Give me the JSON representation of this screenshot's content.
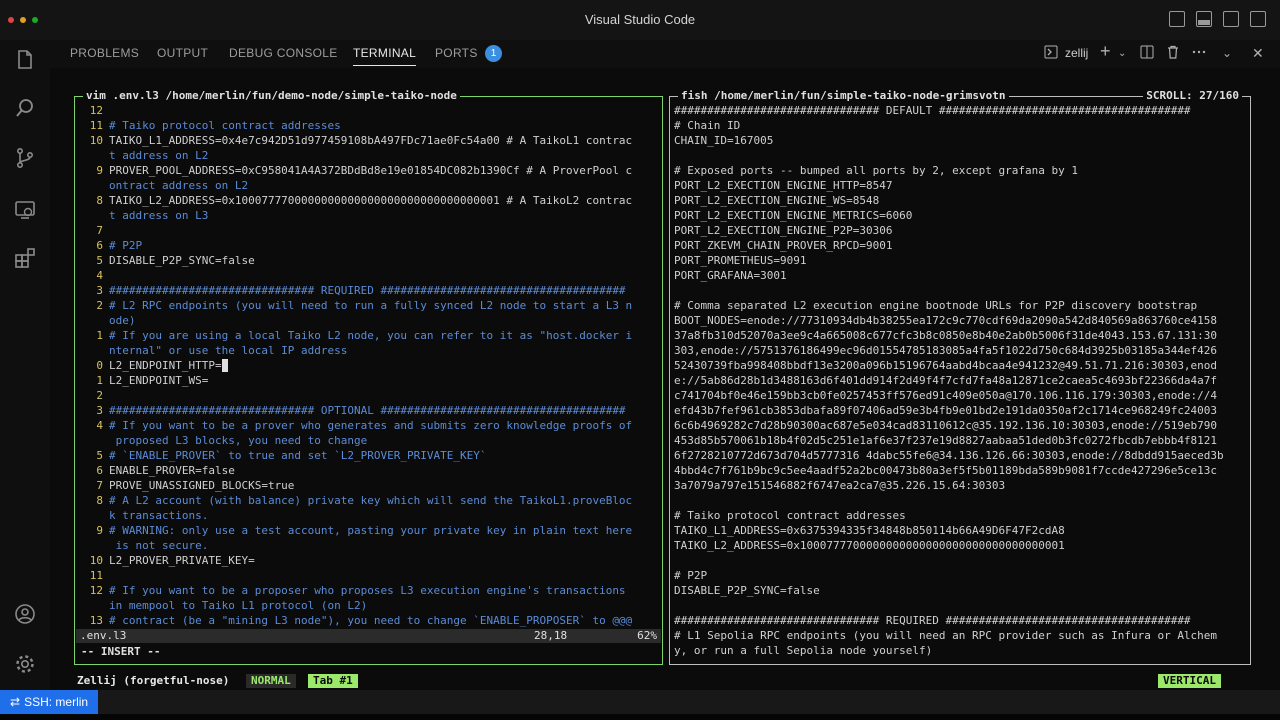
{
  "window": {
    "title": "Visual Studio Code"
  },
  "panel": {
    "tabs": [
      {
        "label": "PROBLEMS"
      },
      {
        "label": "OUTPUT"
      },
      {
        "label": "DEBUG CONSOLE"
      },
      {
        "label": "TERMINAL"
      },
      {
        "label": "PORTS"
      }
    ],
    "ports_badge": "1",
    "terminal_name": "zellij"
  },
  "left_pane": {
    "title": "vim .env.l3 /home/merlin/fun/demo-node/simple-taiko-node",
    "lines": [
      {
        "n": "12",
        "t": "",
        "c": false
      },
      {
        "n": "11",
        "t": "# Taiko protocol contract addresses",
        "c": true
      },
      {
        "n": "10",
        "t": "TAIKO_L1_ADDRESS=0x4e7c942D51d977459108bA497FDc71ae0Fc54a00 # A TaikoL1 contrac",
        "c": false
      },
      {
        "n": "",
        "t": "t address on L2",
        "c": true
      },
      {
        "n": "9",
        "t": "PROVER_POOL_ADDRESS=0xC958041A4A372BDdBd8e19e01854DC082b1390Cf # A ProverPool c",
        "c": false
      },
      {
        "n": "",
        "t": "ontract address on L2",
        "c": true
      },
      {
        "n": "8",
        "t": "TAIKO_L2_ADDRESS=0x1000777700000000000000000000000000000001 # A TaikoL2 contrac",
        "c": false
      },
      {
        "n": "",
        "t": "t address on L3",
        "c": true
      },
      {
        "n": "7",
        "t": "",
        "c": false
      },
      {
        "n": "6",
        "t": "# P2P",
        "c": true
      },
      {
        "n": "5",
        "t": "DISABLE_P2P_SYNC=false",
        "c": false
      },
      {
        "n": "4",
        "t": "",
        "c": false
      },
      {
        "n": "3",
        "t": "############################### REQUIRED #####################################",
        "c": true
      },
      {
        "n": "2",
        "t": "# L2 RPC endpoints (you will need to run a fully synced L2 node to start a L3 n",
        "c": true
      },
      {
        "n": "",
        "t": "ode)",
        "c": true
      },
      {
        "n": "1",
        "t": "# If you are using a local Taiko L2 node, you can refer to it as \"host.docker i",
        "c": true
      },
      {
        "n": "",
        "t": "nternal\" or use the local IP address",
        "c": true
      },
      {
        "n": "0",
        "t": "L2_ENDPOINT_HTTP=",
        "c": false,
        "cursor": true
      },
      {
        "n": "1",
        "t": "L2_ENDPOINT_WS=",
        "c": false
      },
      {
        "n": "2",
        "t": "",
        "c": false
      },
      {
        "n": "3",
        "t": "############################### OPTIONAL #####################################",
        "c": true
      },
      {
        "n": "4",
        "t": "# If you want to be a prover who generates and submits zero knowledge proofs of",
        "c": true
      },
      {
        "n": "",
        "t": " proposed L3 blocks, you need to change",
        "c": true
      },
      {
        "n": "5",
        "t": "# `ENABLE_PROVER` to true and set `L2_PROVER_PRIVATE_KEY`",
        "c": true
      },
      {
        "n": "6",
        "t": "ENABLE_PROVER=false",
        "c": false
      },
      {
        "n": "7",
        "t": "PROVE_UNASSIGNED_BLOCKS=true",
        "c": false
      },
      {
        "n": "8",
        "t": "# A L2 account (with balance) private key which will send the TaikoL1.proveBloc",
        "c": true
      },
      {
        "n": "",
        "t": "k transactions.",
        "c": true
      },
      {
        "n": "9",
        "t": "# WARNING: only use a test account, pasting your private key in plain text here",
        "c": true
      },
      {
        "n": "",
        "t": " is not secure.",
        "c": true
      },
      {
        "n": "10",
        "t": "L2_PROVER_PRIVATE_KEY=",
        "c": false
      },
      {
        "n": "11",
        "t": "",
        "c": false
      },
      {
        "n": "12",
        "t": "# If you want to be a proposer who proposes L3 execution engine's transactions",
        "c": true
      },
      {
        "n": "",
        "t": "in mempool to Taiko L1 protocol (on L2)",
        "c": true
      },
      {
        "n": "13",
        "t": "# contract (be a \"mining L3 node\"), you need to change `ENABLE_PROPOSER` to @@@",
        "c": true
      }
    ],
    "status": {
      "file": ".env.l3",
      "position": "28,18",
      "percent": "62%"
    },
    "mode": "-- INSERT --"
  },
  "right_pane": {
    "title": "fish /home/merlin/fun/simple-taiko-node-grimsvotn",
    "scroll": "SCROLL:  27/160",
    "lines": [
      {
        "t": "############################### DEFAULT ######################################",
        "c": false
      },
      {
        "t": "# Chain ID",
        "c": false
      },
      {
        "t": "CHAIN_ID=167005",
        "c": false
      },
      {
        "t": "",
        "c": false
      },
      {
        "t": "# Exposed ports -- bumped all ports by 2, except grafana by 1",
        "c": false
      },
      {
        "t": "PORT_L2_EXECTION_ENGINE_HTTP=8547",
        "c": false
      },
      {
        "t": "PORT_L2_EXECTION_ENGINE_WS=8548",
        "c": false
      },
      {
        "t": "PORT_L2_EXECTION_ENGINE_METRICS=6060",
        "c": false
      },
      {
        "t": "PORT_L2_EXECTION_ENGINE_P2P=30306",
        "c": false
      },
      {
        "t": "PORT_ZKEVM_CHAIN_PROVER_RPCD=9001",
        "c": false
      },
      {
        "t": "PORT_PROMETHEUS=9091",
        "c": false
      },
      {
        "t": "PORT_GRAFANA=3001",
        "c": false
      },
      {
        "t": "",
        "c": false
      },
      {
        "t": "# Comma separated L2 execution engine bootnode URLs for P2P discovery bootstrap",
        "c": false
      },
      {
        "t": "BOOT_NODES=enode://77310934db4b38255ea172c9c770cdf69da2090a542d840569a863760ce4158",
        "c": false
      },
      {
        "t": "37a8fb310d52070a3ee9c4a665008c677cfc3b8c0850e8b40e2ab0b5006f31de4043.153.67.131:30",
        "c": false
      },
      {
        "t": "303,enode://5751376186499ec96d01554785183085a4fa5f1022d750c684d3925b03185a344ef426",
        "c": false
      },
      {
        "t": "52430739fba998408bbdf13e3200a096b15196764aabd4bcaa4e941232@49.51.71.216:30303,enod",
        "c": false
      },
      {
        "t": "e://5ab86d28b1d3488163d6f401dd914f2d49f4f7cfd7fa48a12871ce2caea5c4693bf22366da4a7f",
        "c": false
      },
      {
        "t": "c741704bf0e46e159bb3cb0fe0257453ff576ed91c409e050a@170.106.116.179:30303,enode://4",
        "c": false
      },
      {
        "t": "efd43b7fef961cb3853dbafa89f07406ad59e3b4fb9e01bd2e191da0350af2c1714ce968249fc24003",
        "c": false
      },
      {
        "t": "6c6b4969282c7d28b90300ac687e5e034cad83110612c@35.192.136.10:30303,enode://519eb790",
        "c": false
      },
      {
        "t": "453d85b570061b18b4f02d5c251e1af6e37f237e19d8827aabaa51ded0b3fc0272fbcdb7ebbb4f8121",
        "c": false
      },
      {
        "t": "6f2728210772d673d704d5777316 4dabc55fe6@34.136.126.66:30303,enode://8dbdd915aeced3b",
        "c": false
      },
      {
        "t": "4bbd4c7f761b9bc9c5ee4aadf52a2bc00473b80a3ef5f5b01189bda589b9081f7ccde427296e5ce13c",
        "c": false
      },
      {
        "t": "3a7079a797e151546882f6747ea2ca7@35.226.15.64:30303",
        "c": false
      },
      {
        "t": "",
        "c": false
      },
      {
        "t": "# Taiko protocol contract addresses",
        "c": false
      },
      {
        "t": "TAIKO_L1_ADDRESS=0x6375394335f34848b850114b66A49D6F47F2cdA8",
        "c": false
      },
      {
        "t": "TAIKO_L2_ADDRESS=0x1000777700000000000000000000000000000001",
        "c": false
      },
      {
        "t": "",
        "c": false
      },
      {
        "t": "# P2P",
        "c": false
      },
      {
        "t": "DISABLE_P2P_SYNC=false",
        "c": false
      },
      {
        "t": "",
        "c": false
      },
      {
        "t": "############################### REQUIRED #####################################",
        "c": false
      },
      {
        "t": "# L1 Sepolia RPC endpoints (you will need an RPC provider such as Infura or Alchem",
        "c": false
      },
      {
        "t": "y, or run a full Sepolia node yourself)",
        "c": false
      }
    ]
  },
  "zellij": {
    "session": "Zellij (forgetful-nose)",
    "mode": "NORMAL",
    "tab": "Tab #1",
    "layout": "VERTICAL"
  },
  "statusbar": {
    "remote": "SSH: merlin"
  },
  "colors": {
    "accent": "#1f6feb",
    "active_pane_border": "#7cd46b",
    "zellij_green": "#9be86b"
  }
}
